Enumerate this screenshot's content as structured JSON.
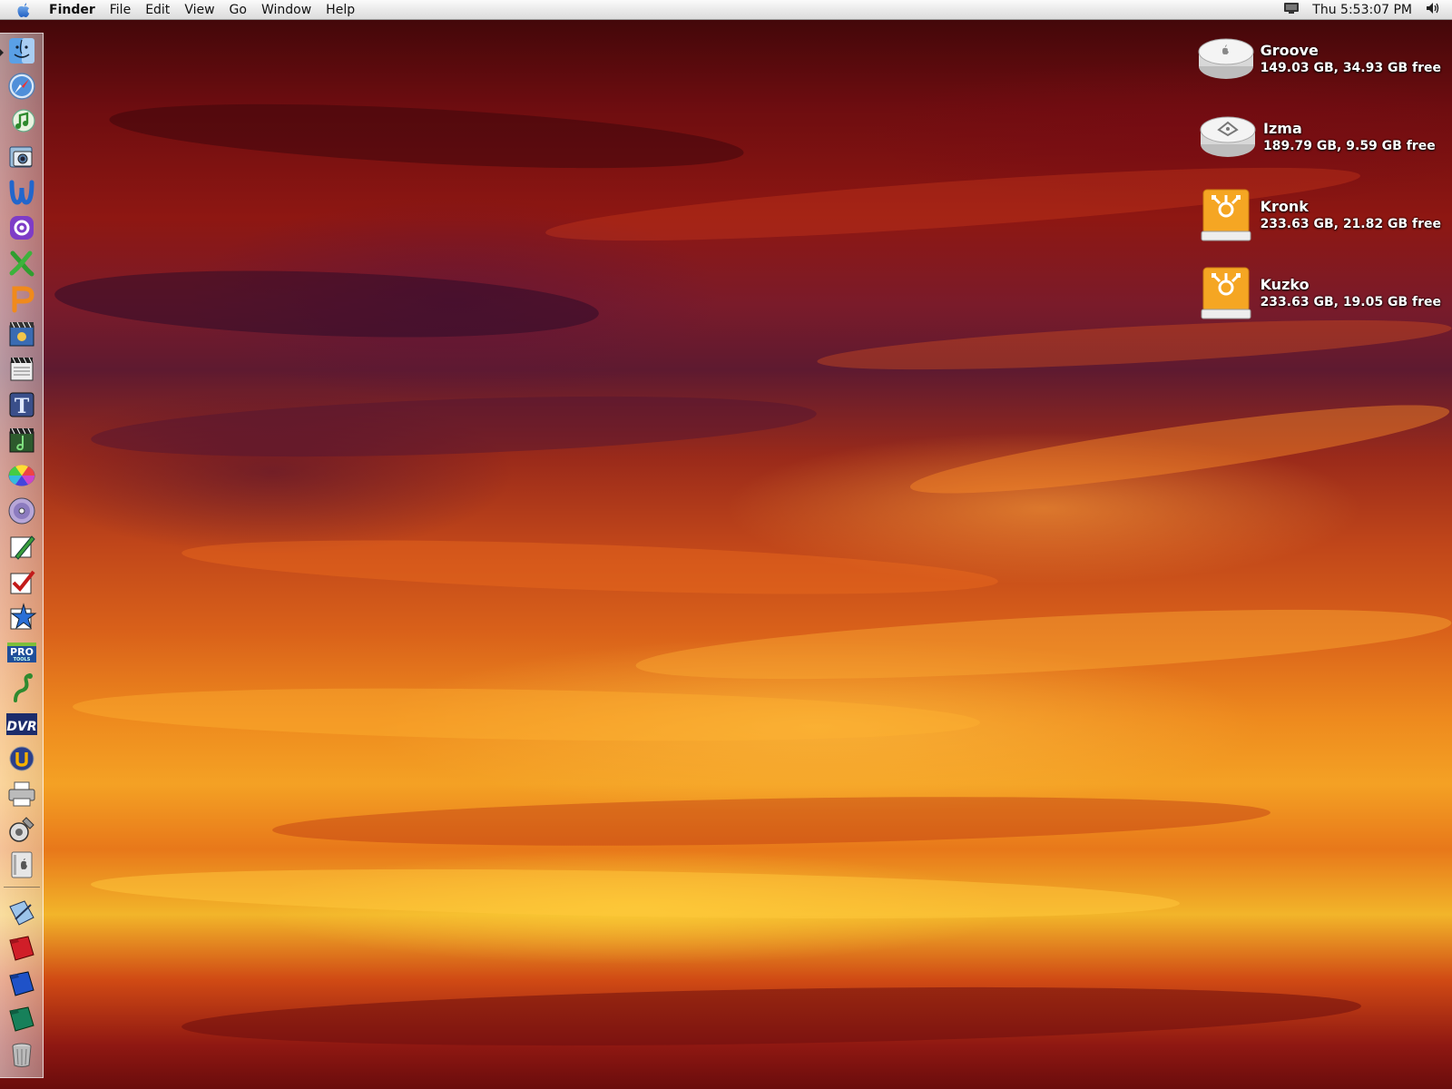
{
  "menubar": {
    "app_name": "Finder",
    "menus": [
      "File",
      "Edit",
      "View",
      "Go",
      "Window",
      "Help"
    ],
    "clock": "Thu 5:53:07 PM",
    "status_icons": [
      "display-icon",
      "volume-icon"
    ]
  },
  "desktop": {
    "volumes": [
      {
        "name": "Groove",
        "info": "149.03 GB, 34.93 GB free",
        "icon": "internal-hard-disk-icon"
      },
      {
        "name": "Izma",
        "info": "189.79 GB, 9.59 GB free",
        "icon": "internal-hard-disk-icon"
      },
      {
        "name": "Kronk",
        "info": "233.63 GB, 21.82 GB free",
        "icon": "firewire-drive-icon"
      },
      {
        "name": "Kuzko",
        "info": "233.63 GB, 19.05 GB free",
        "icon": "firewire-drive-icon"
      }
    ]
  },
  "dock": {
    "apps": [
      "finder-icon",
      "safari-icon",
      "itunes-icon",
      "iphoto-icon",
      "microsoft-word-icon",
      "microsoft-entourage-icon",
      "microsoft-excel-icon",
      "microsoft-powerpoint-icon",
      "imovie-icon",
      "final-cut-icon",
      "livetype-icon",
      "soundtrack-icon",
      "color-wheel-icon",
      "dvd-studio-pro-icon",
      "pen-app-icon",
      "checkmark-app-icon",
      "star-app-icon",
      "pro-tools-icon",
      "snake-app-icon",
      "dvr-icon",
      "unreal-icon",
      "printer-icon",
      "utility-icon",
      "system-preferences-icon"
    ],
    "others": [
      "documents-folder-icon",
      "red-folder-icon",
      "blue-folder-icon",
      "green-folder-icon",
      "trash-icon"
    ],
    "pro_tools_label": "PRO",
    "pro_tools_sublabel": "TOOLS",
    "dvr_label": "DVR",
    "livetype_label": "T"
  }
}
